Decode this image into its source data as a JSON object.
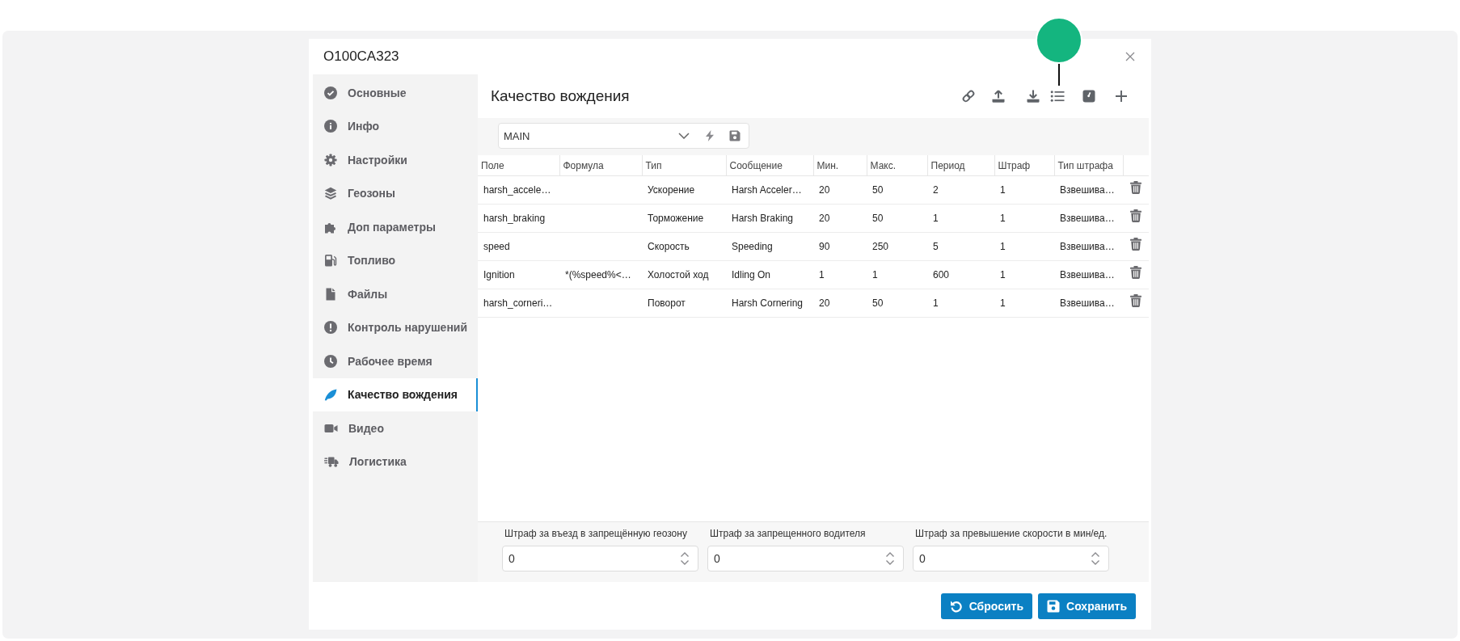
{
  "dialog": {
    "title": "O100CA323"
  },
  "sidebar": {
    "items": [
      {
        "label": "Основные",
        "selected": false
      },
      {
        "label": "Инфо",
        "selected": false
      },
      {
        "label": "Настройки",
        "selected": false
      },
      {
        "label": "Геозоны",
        "selected": false
      },
      {
        "label": "Доп параметры",
        "selected": false
      },
      {
        "label": "Топливо",
        "selected": false
      },
      {
        "label": "Файлы",
        "selected": false
      },
      {
        "label": "Контроль нарушений",
        "selected": false
      },
      {
        "label": "Рабочее время",
        "selected": false
      },
      {
        "label": "Качество вождения",
        "selected": true
      },
      {
        "label": "Видео",
        "selected": false
      },
      {
        "label": "Логистика",
        "selected": false
      }
    ]
  },
  "panel": {
    "title": "Качество вождения",
    "preset_select": {
      "value": "MAIN"
    },
    "table": {
      "columns": [
        "Поле",
        "Формула",
        "Тип",
        "Сообщение",
        "Мин.",
        "Макс.",
        "Период",
        "Штраф",
        "Тип штрафа"
      ],
      "rows": [
        {
          "field": "harsh_accele…",
          "type": "Ускорение",
          "message": "Harsh Acceler…",
          "min": "20",
          "max": "50",
          "period": "2",
          "penalty": "1",
          "penalty_type": "Взвешива…"
        },
        {
          "field": "harsh_braking",
          "type": "Торможение",
          "message": "Harsh Braking",
          "min": "20",
          "max": "50",
          "period": "1",
          "penalty": "1",
          "penalty_type": "Взвешива…"
        },
        {
          "field": "speed",
          "type": "Скорость",
          "message": "Speeding",
          "min": "90",
          "max": "250",
          "period": "5",
          "penalty": "1",
          "penalty_type": "Взвешива…"
        },
        {
          "field": "Ignition",
          "formula": "*(%speed%<…",
          "type": "Холостой ход",
          "message": "Idling On",
          "min": "1",
          "max": "1",
          "period": "600",
          "penalty": "1",
          "penalty_type": "Взвешива…"
        },
        {
          "field": "harsh_corneri…",
          "type": "Поворот",
          "message": "Harsh Cornering",
          "min": "20",
          "max": "50",
          "period": "1",
          "penalty": "1",
          "penalty_type": "Взвешива…"
        }
      ]
    },
    "penalties": [
      {
        "label": "Штраф за въезд в запрещённую геозону",
        "value": "0"
      },
      {
        "label": "Штраф за запрещенного водителя",
        "value": "0"
      },
      {
        "label": "Штраф за превышение скорости в мин/ед.",
        "value": "0"
      }
    ]
  },
  "buttons": [
    {
      "kind": "reset",
      "label": "Сбросить"
    },
    {
      "kind": "save",
      "label": "Сохранить"
    }
  ]
}
